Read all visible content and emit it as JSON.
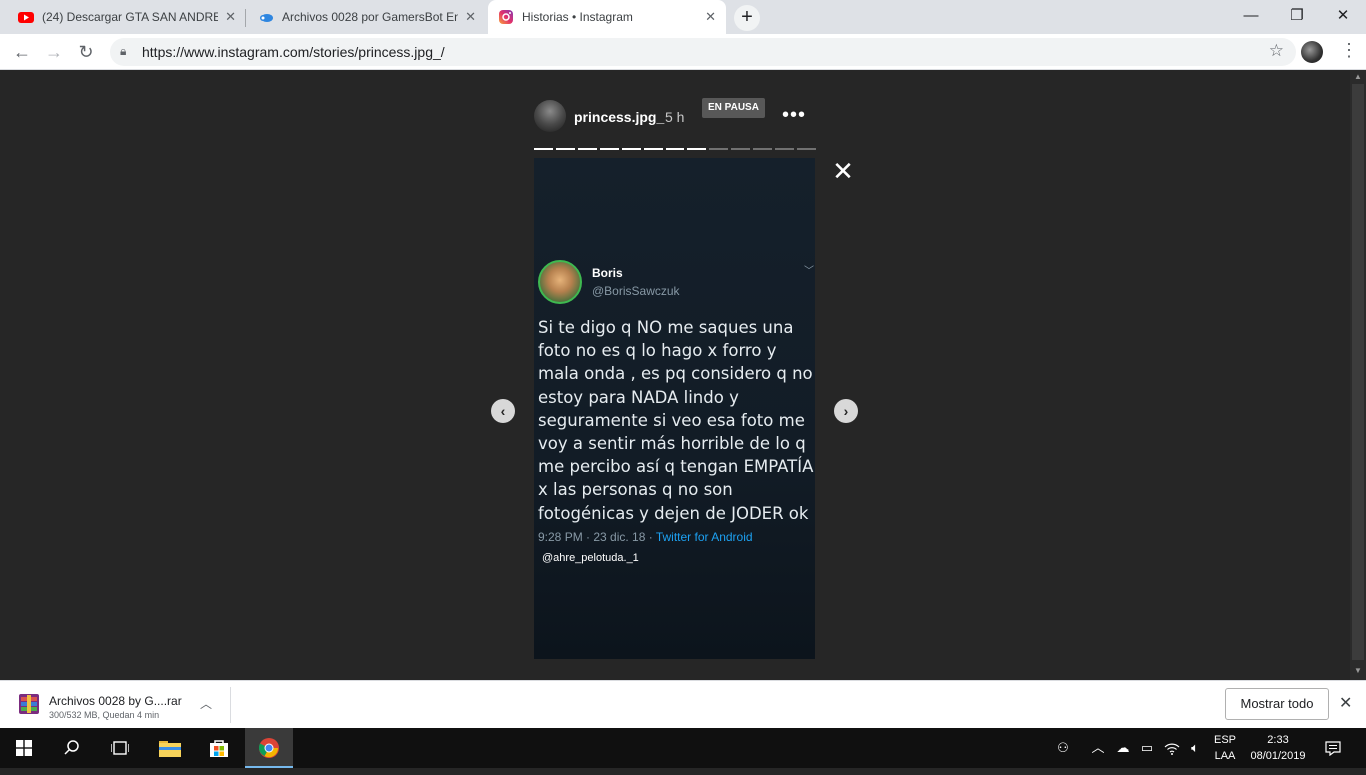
{
  "browser": {
    "tabs": [
      {
        "title": "(24) Descargar GTA SAN ANDREAS",
        "favicon": "youtube-icon"
      },
      {
        "title": "Archivos 0028 por GamersBot En",
        "favicon": "cloud-icon"
      },
      {
        "title": "Historias • Instagram",
        "favicon": "instagram-icon"
      }
    ],
    "url": "https://www.instagram.com/stories/princess.jpg_/"
  },
  "story": {
    "username": "princess.jpg_",
    "time": "5 h",
    "paused_label": "EN PAUSA",
    "segments_total": 13,
    "segments_done": 8,
    "tweet": {
      "name": "Boris",
      "handle": "@BorisSawczuk",
      "text": "Si te digo q NO me saques una foto no es q lo hago x forro y mala onda , es pq considero q no estoy para NADA lindo y seguramente si veo esa foto me voy a sentir más horrible de lo q me percibo así q tengan EMPATÍA x las personas q no son fotogénicas y dejen de JODER ok",
      "meta": "9:28 PM · 23 dic. 18 · ",
      "app": "Twitter for Android"
    },
    "credit": "@ahre_pelotuda._1"
  },
  "download": {
    "name": "Archivos 0028 by G....rar",
    "status": "300/532 MB, Quedan 4 min",
    "show_all": "Mostrar todo"
  },
  "taskbar": {
    "lang_line1": "ESP",
    "lang_line2": "LAA",
    "time": "2:33",
    "date": "08/01/2019"
  }
}
